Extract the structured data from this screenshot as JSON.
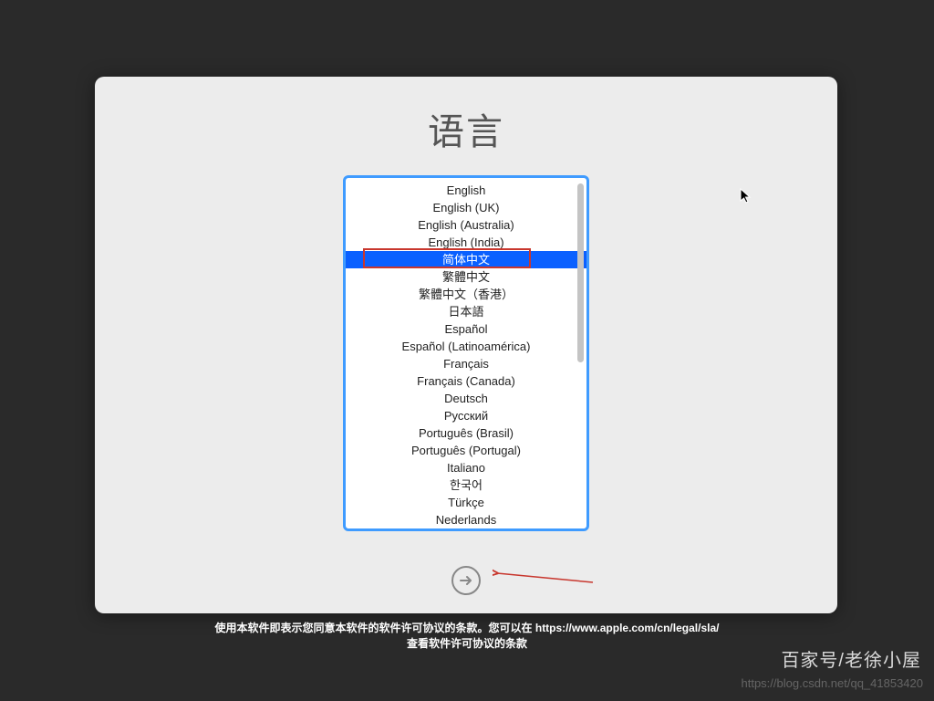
{
  "title": "语言",
  "selected_index": 4,
  "languages": [
    "English",
    "English (UK)",
    "English (Australia)",
    "English (India)",
    "简体中文",
    "繁體中文",
    "繁體中文（香港）",
    "日本語",
    "Español",
    "Español (Latinoamérica)",
    "Français",
    "Français (Canada)",
    "Deutsch",
    "Русский",
    "Português (Brasil)",
    "Português (Portugal)",
    "Italiano",
    "한국어",
    "Türkçe",
    "Nederlands"
  ],
  "footer": {
    "line1_a": "使用本软件即表示您同意本软件的软件许可协议的条款。您可以在 ",
    "link": "https://www.apple.com/cn/legal/sla/",
    "line2": "查看软件许可协议的条款"
  },
  "watermark1": "百家号/老徐小屋",
  "watermark2": "https://blog.csdn.net/qq_41853420"
}
